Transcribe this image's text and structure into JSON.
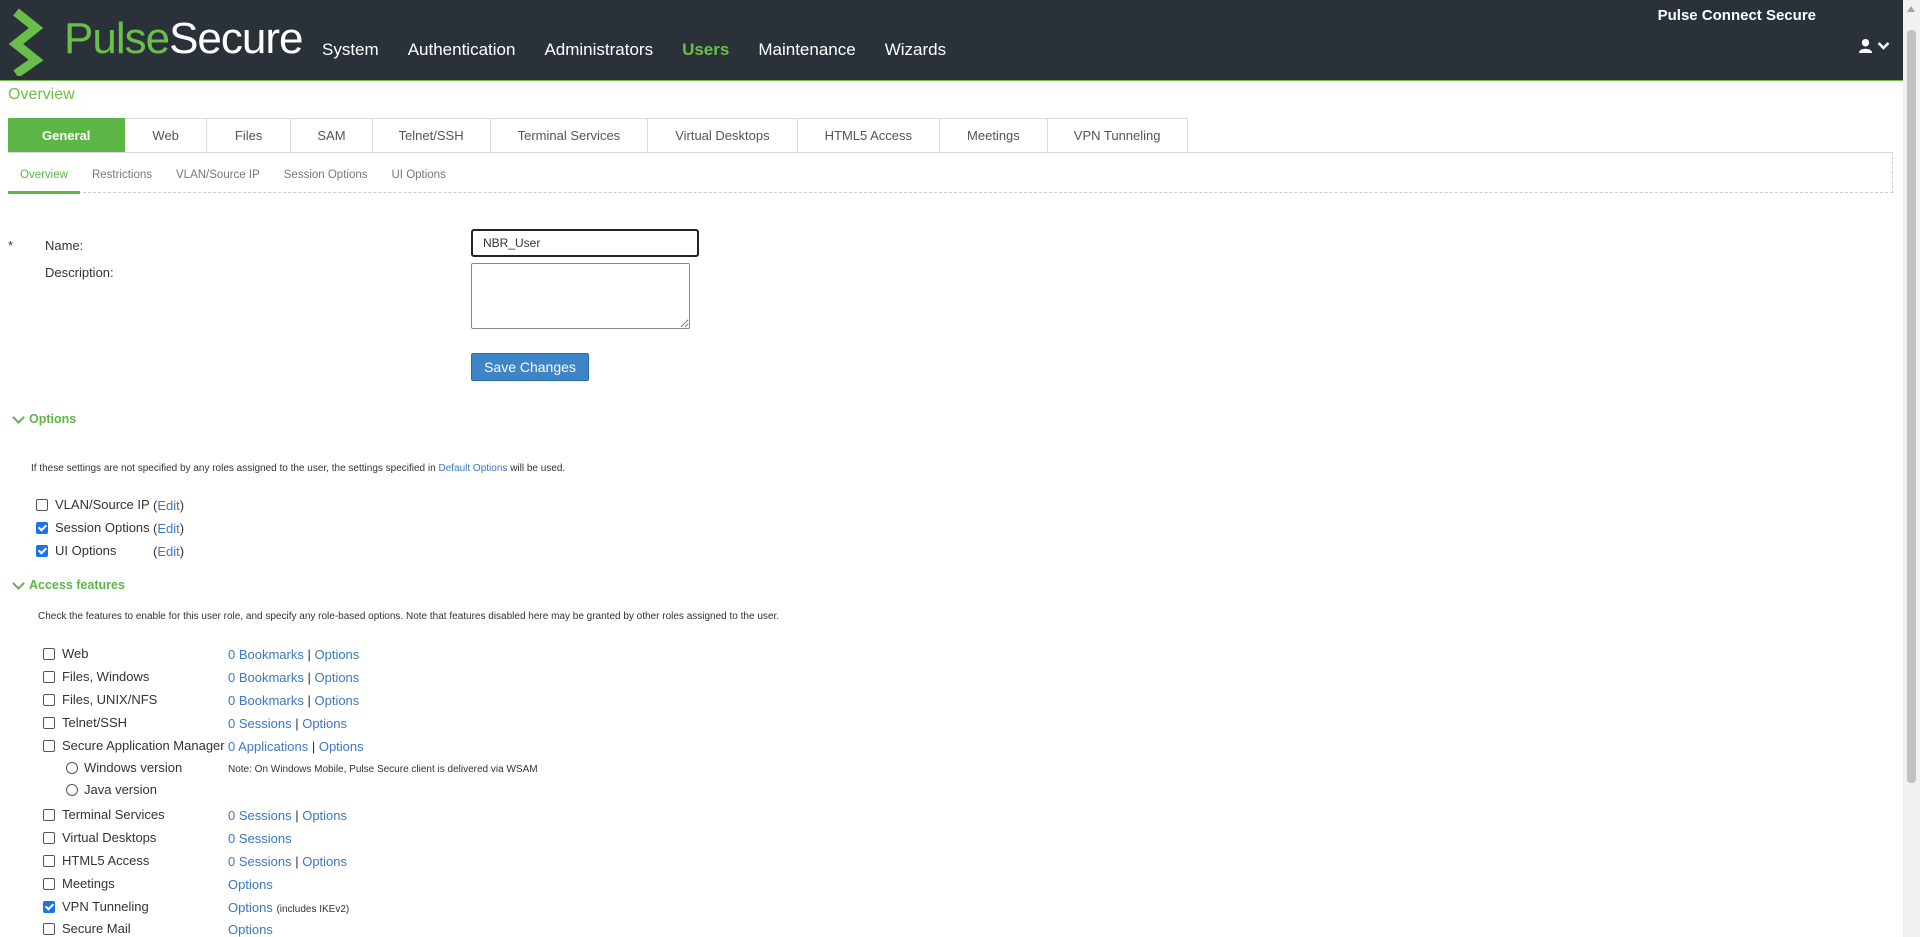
{
  "header": {
    "logo_pulse": "Pulse",
    "logo_secure": "Secure",
    "product": "Pulse Connect Secure",
    "nav": [
      {
        "label": "System",
        "active": false
      },
      {
        "label": "Authentication",
        "active": false
      },
      {
        "label": "Administrators",
        "active": false
      },
      {
        "label": "Users",
        "active": true
      },
      {
        "label": "Maintenance",
        "active": false
      },
      {
        "label": "Wizards",
        "active": false
      }
    ],
    "user_icon": "user-icon",
    "colors": {
      "bg": "#2b3138",
      "accent": "#6abf4b"
    }
  },
  "page": {
    "title": "Overview"
  },
  "tabs": [
    "General",
    "Web",
    "Files",
    "SAM",
    "Telnet/SSH",
    "Terminal Services",
    "Virtual Desktops",
    "HTML5 Access",
    "Meetings",
    "VPN Tunneling"
  ],
  "subtabs": [
    "Overview",
    "Restrictions",
    "VLAN/Source IP",
    "Session Options",
    "UI Options"
  ],
  "form": {
    "required_mark": "*",
    "name_label": "Name:",
    "name_value": "NBR_User",
    "description_label": "Description:",
    "description_value": "",
    "save_label": "Save Changes"
  },
  "options": {
    "heading": "Options",
    "note_prefix": "If these settings are not specified by any roles assigned to the user, the settings specified in",
    "note_link": "Default Options",
    "note_suffix": "will be used.",
    "items": [
      {
        "label": "VLAN/Source IP",
        "checked": false,
        "edit": "Edit"
      },
      {
        "label": "Session Options",
        "checked": true,
        "edit": "Edit"
      },
      {
        "label": "UI Options",
        "checked": true,
        "edit": "Edit"
      }
    ]
  },
  "access": {
    "heading": "Access features",
    "note": "Check the features to enable for this user role, and specify any role-based options. Note that features disabled here may be granted by other roles assigned to the user.",
    "features": [
      {
        "label": "Web",
        "checked": false,
        "link1": "0 Bookmarks",
        "link2": "Options"
      },
      {
        "label": "Files, Windows",
        "checked": false,
        "link1": "0 Bookmarks",
        "link2": "Options"
      },
      {
        "label": "Files, UNIX/NFS",
        "checked": false,
        "link1": "0 Bookmarks",
        "link2": "Options"
      },
      {
        "label": "Telnet/SSH",
        "checked": false,
        "link1": "0 Sessions",
        "link2": "Options"
      },
      {
        "label": "Secure Application Manager",
        "checked": false,
        "link1": "0 Applications",
        "link2": "Options"
      }
    ],
    "sam_versions": [
      {
        "label": "Windows version",
        "note": "Note: On Windows Mobile, Pulse Secure client is delivered via WSAM"
      },
      {
        "label": "Java version"
      }
    ],
    "features2": [
      {
        "label": "Terminal Services",
        "checked": false,
        "link1": "0 Sessions",
        "link2": "Options"
      },
      {
        "label": "Virtual Desktops",
        "checked": false,
        "link1": "0 Sessions"
      },
      {
        "label": "HTML5 Access",
        "checked": false,
        "link1": "0 Sessions",
        "link2": "Options"
      },
      {
        "label": "Meetings",
        "checked": false,
        "link1": "Options"
      },
      {
        "label": "VPN Tunneling",
        "checked": true,
        "link1": "Options",
        "extra": "(includes IKEv2)"
      },
      {
        "label": "Secure Mail",
        "checked": false,
        "link1": "Options"
      }
    ]
  }
}
